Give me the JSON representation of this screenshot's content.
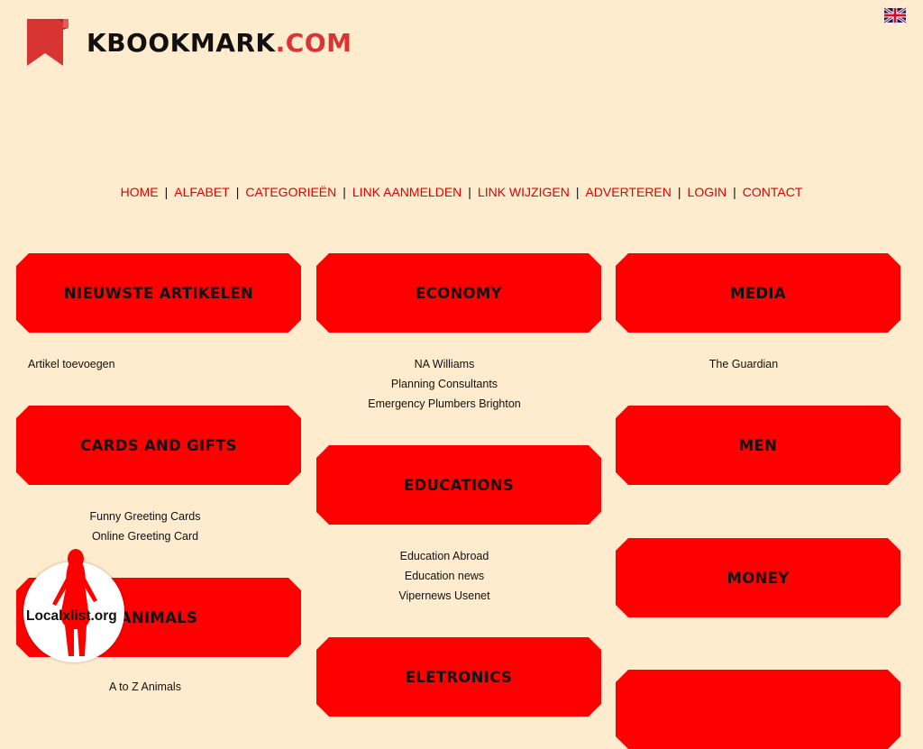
{
  "logo": {
    "text_main": "KBOOKMARK",
    "text_ext": ".COM"
  },
  "flag_icon": "uk-flag-icon",
  "nav": [
    {
      "label": "HOME"
    },
    {
      "label": "ALFABET"
    },
    {
      "label": "CATEGORIEËN"
    },
    {
      "label": "LINK AANMELDEN"
    },
    {
      "label": "LINK WIJZIGEN"
    },
    {
      "label": "ADVERTEREN"
    },
    {
      "label": "LOGIN"
    },
    {
      "label": "CONTACT"
    }
  ],
  "nav_separator": "|",
  "categories": {
    "nieuwste": {
      "title": "NIEUWSTE ARTIKELEN",
      "links": [
        "Artikel toevoegen"
      ]
    },
    "economy": {
      "title": "ECONOMY",
      "links": [
        "NA Williams",
        "Planning Consultants",
        "Emergency Plumbers Brighton"
      ]
    },
    "media": {
      "title": "MEDIA",
      "links": [
        "The Guardian"
      ]
    },
    "cards": {
      "title": "CARDS AND GIFTS",
      "links": [
        "Funny Greeting Cards",
        "Online Greeting Card"
      ]
    },
    "educations": {
      "title": "EDUCATIONS",
      "links": [
        "Education Abroad",
        "Education news",
        "Vipernews Usenet"
      ]
    },
    "men": {
      "title": "MEN",
      "links": []
    },
    "animals": {
      "title": "ANIMALS",
      "links": [
        "A to Z Animals"
      ]
    },
    "money": {
      "title": "MONEY",
      "links": []
    },
    "eletronics": {
      "title": "ELETRONICS",
      "links": []
    }
  },
  "badge": {
    "text": "Localxlist.org"
  },
  "colors": {
    "background": "#FFEBCD",
    "accent": "#FF0000",
    "nav_link": "#E00000"
  }
}
